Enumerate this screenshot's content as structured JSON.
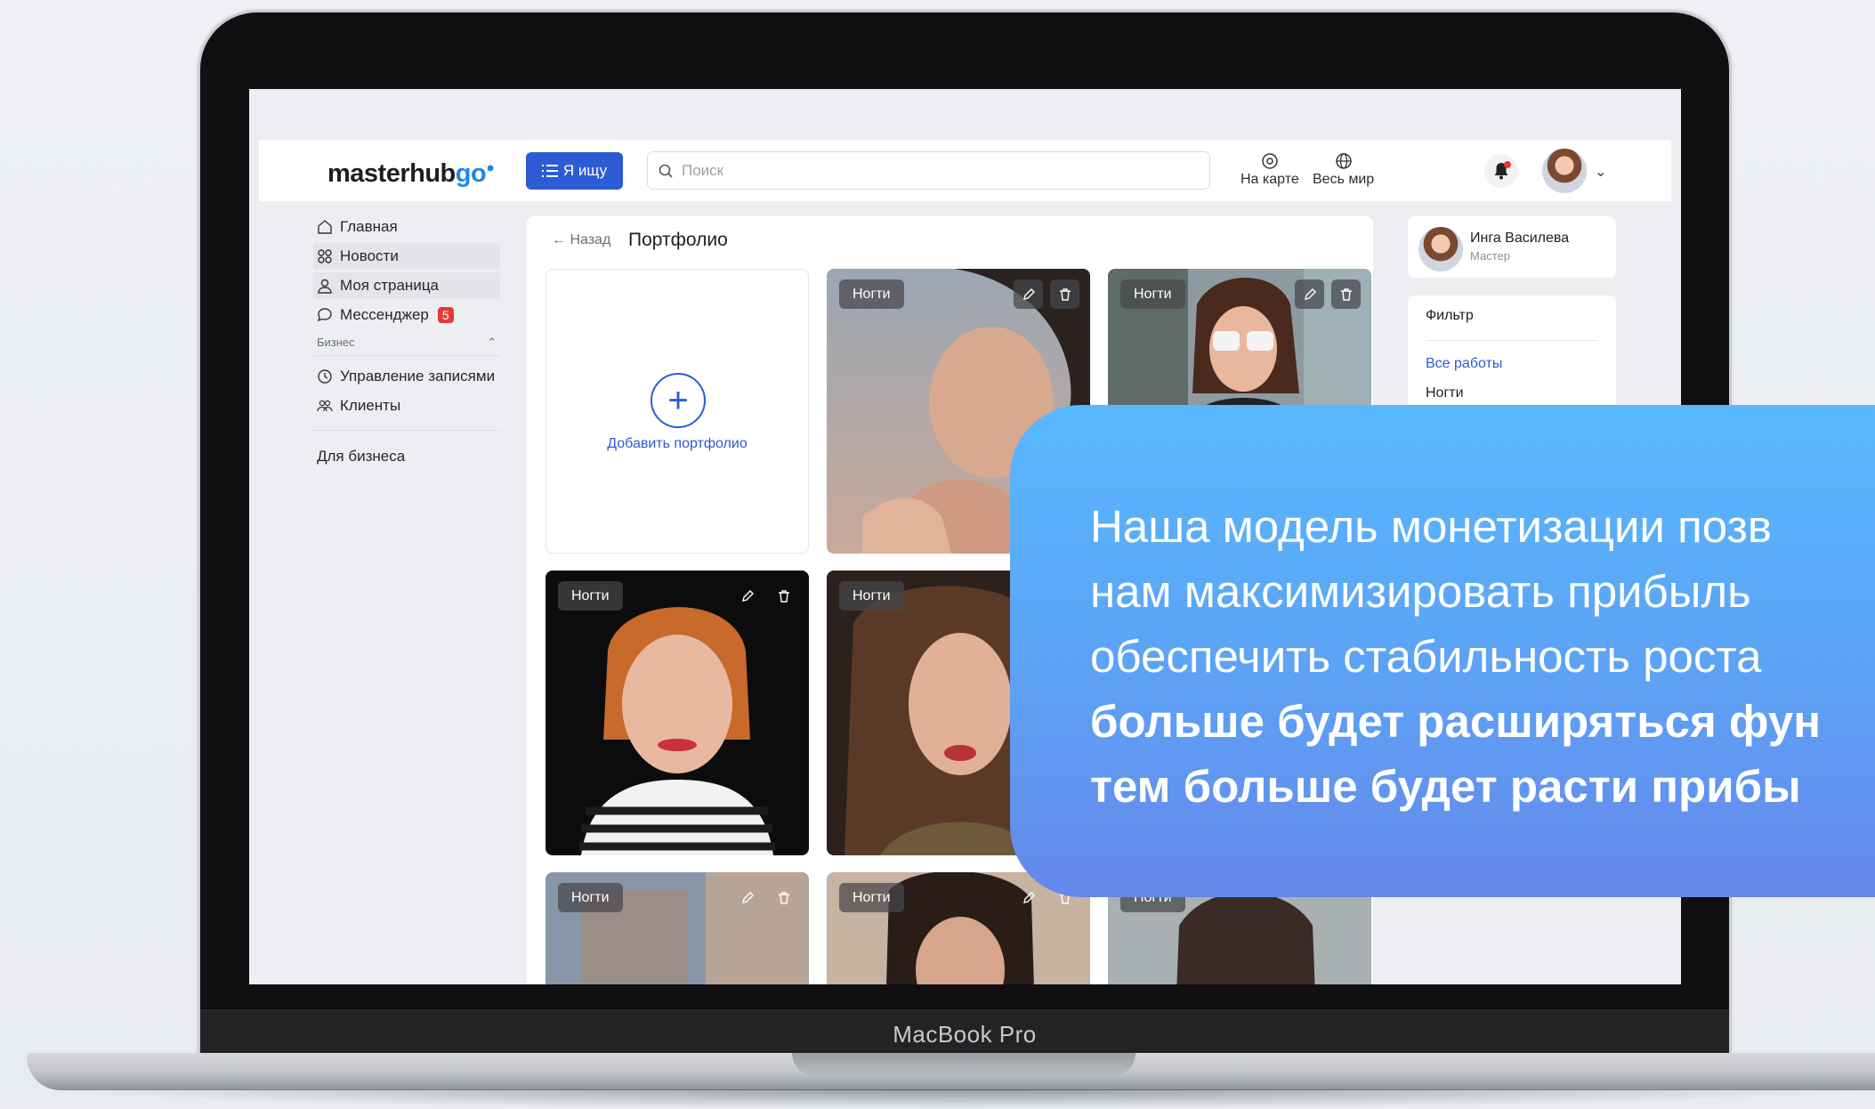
{
  "device": {
    "brand_label": "MacBook Pro"
  },
  "header": {
    "logo_main": "masterhub",
    "logo_accent": "go",
    "seek_button": "Я ищу",
    "search_placeholder": "Поиск",
    "map_label": "На карте",
    "world_label": "Весь мир"
  },
  "sidebar": {
    "items": [
      {
        "label": "Главная",
        "icon": "home-icon"
      },
      {
        "label": "Новости",
        "icon": "grid-icon"
      },
      {
        "label": "Моя страница",
        "icon": "user-icon"
      },
      {
        "label": "Мессенджер",
        "icon": "chat-icon",
        "badge": "5"
      }
    ],
    "section_title": "Бизнес",
    "section_items": [
      {
        "label": "Управление записями",
        "icon": "clock-icon"
      },
      {
        "label": "Клиенты",
        "icon": "users-icon"
      }
    ],
    "footer_link": "Для бизнеса"
  },
  "main": {
    "back_label": "← Назад",
    "title": "Портфолио",
    "add_label": "Добавить портфолио",
    "tiles": [
      {
        "tag": "Ногти"
      },
      {
        "tag": "Ногти"
      },
      {
        "tag": "Ногти"
      },
      {
        "tag": "Ногти"
      },
      {
        "tag": "Ногти"
      },
      {
        "tag": "Ногти"
      },
      {
        "tag": "Ногти"
      }
    ]
  },
  "profile": {
    "name": "Инга Василева",
    "role": "Мастер"
  },
  "filter": {
    "title": "Фильтр",
    "items": [
      {
        "label": "Все работы",
        "color": "#2c5bd4"
      },
      {
        "label": "Ногти",
        "color": "#1d1f24"
      }
    ]
  },
  "promo": {
    "line1": "Наша модель монетизации позв",
    "line2": "нам максимизировать прибыль",
    "line3": "обеспечить стабильность роста",
    "line4": "больше будет расширяться фун",
    "line5": "тем больше будет расти прибы"
  },
  "colors": {
    "accent": "#2c5bd4",
    "promo_top": "#58b8fd",
    "promo_bottom": "#6588ea",
    "badge": "#e53935"
  }
}
